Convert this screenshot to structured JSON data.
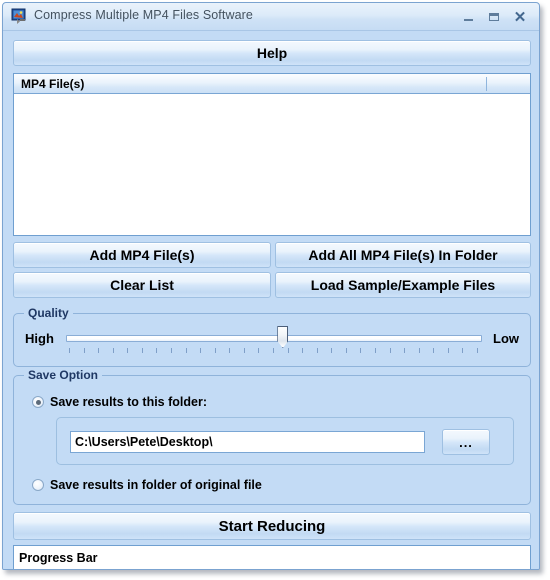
{
  "window": {
    "title": "Compress Multiple MP4 Files Software",
    "icon": "app-icon",
    "controls": {
      "minimize": "–",
      "maximize": "☐",
      "close": "✕"
    }
  },
  "toolbar": {
    "help_label": "Help"
  },
  "file_list": {
    "column_header": "MP4 File(s)",
    "rows": []
  },
  "buttons": {
    "add_files": "Add MP4 File(s)",
    "add_folder": "Add All MP4 File(s) In Folder",
    "clear_list": "Clear List",
    "load_sample": "Load Sample/Example Files",
    "browse": "...",
    "start": "Start Reducing"
  },
  "quality": {
    "group_title": "Quality",
    "left_label": "High",
    "right_label": "Low",
    "slider_value": 52,
    "slider_min": 0,
    "slider_max": 100,
    "tick_count": 29
  },
  "save_option": {
    "group_title": "Save Option",
    "option_folder_label": "Save results to this folder:",
    "option_original_label": "Save results in folder of original file",
    "selected": "folder",
    "path_value": "C:\\Users\\Pete\\Desktop\\",
    "path_placeholder": ""
  },
  "status": {
    "progress_label": "Progress Bar"
  },
  "colors": {
    "window_bg": "#c3dbf5",
    "frame_border": "#7ba3d0",
    "group_title": "#1f3864",
    "title_text": "#44525f"
  }
}
